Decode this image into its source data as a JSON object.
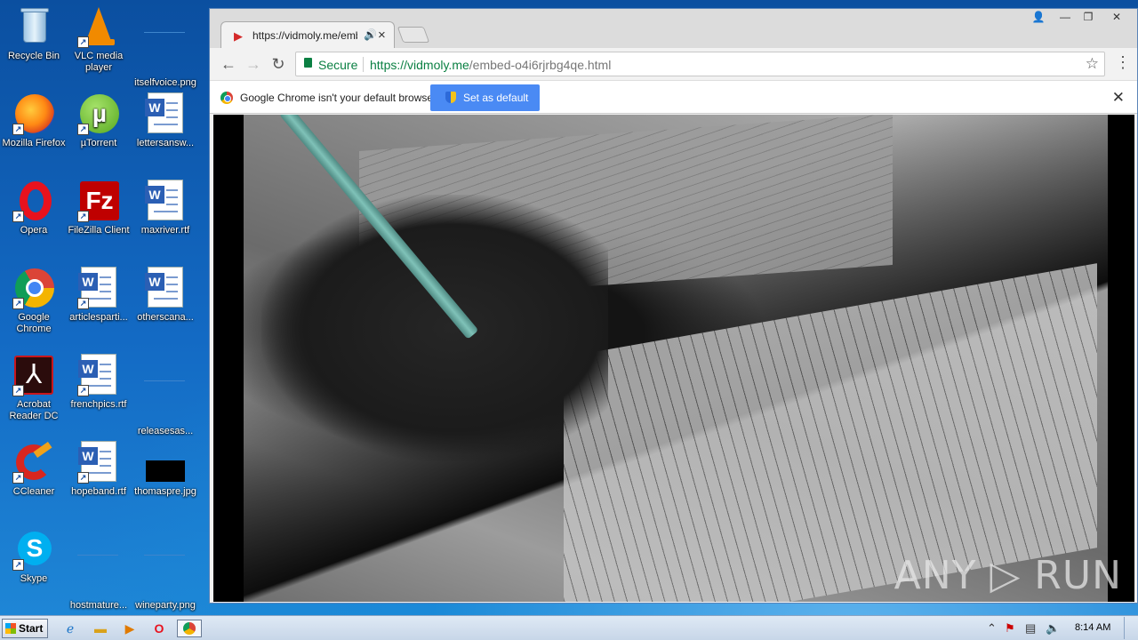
{
  "desktop": {
    "icons": [
      {
        "label": "Recycle Bin"
      },
      {
        "label": "VLC media player"
      },
      {
        "label": "itselfvoice.png"
      },
      {
        "label": "Mozilla Firefox"
      },
      {
        "label": "µTorrent"
      },
      {
        "label": "lettersansw..."
      },
      {
        "label": "Opera"
      },
      {
        "label": "FileZilla Client"
      },
      {
        "label": "maxriver.rtf"
      },
      {
        "label": "Google Chrome"
      },
      {
        "label": "articlesparti..."
      },
      {
        "label": "otherscana..."
      },
      {
        "label": "Acrobat Reader DC"
      },
      {
        "label": "frenchpics.rtf"
      },
      {
        "label": "releasesas..."
      },
      {
        "label": "CCleaner"
      },
      {
        "label": "hopeband.rtf"
      },
      {
        "label": "thomaspre.jpg"
      },
      {
        "label": "Skype"
      },
      {
        "label": "hostmature..."
      },
      {
        "label": "wineparty.png"
      }
    ]
  },
  "browser": {
    "tab_title": "https://vidmoly.me/emb",
    "address": {
      "secure_label": "Secure",
      "url_host": "https://vidmoly.me",
      "url_path": "/embed-o4i6rjrbg4qe.html"
    },
    "infobar": {
      "message": "Google Chrome isn't your default browser.",
      "button_label": "Set as default"
    }
  },
  "video": {
    "watermark": "ANY ▷ RUN"
  },
  "taskbar": {
    "start_label": "Start",
    "clock": "8:14 AM"
  },
  "colors": {
    "secure_green": "#0b8043",
    "infobar_button": "#4a8af4"
  }
}
